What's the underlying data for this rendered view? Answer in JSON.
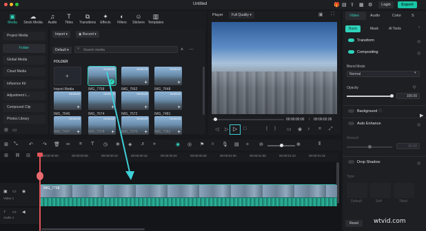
{
  "window": {
    "title": "Untitled",
    "login_label": "Login",
    "export_label": "Export"
  },
  "media_tabs": [
    {
      "label": "Media",
      "icon": "media-icon"
    },
    {
      "label": "Stock Media",
      "icon": "cloud-icon"
    },
    {
      "label": "Audio",
      "icon": "music-icon"
    },
    {
      "label": "Titles",
      "icon": "title-icon"
    },
    {
      "label": "Transitions",
      "icon": "transition-icon"
    },
    {
      "label": "Effects",
      "icon": "effects-icon"
    },
    {
      "label": "Filters",
      "icon": "filter-icon"
    },
    {
      "label": "Stickers",
      "icon": "sticker-icon"
    },
    {
      "label": "Templates",
      "icon": "template-icon"
    }
  ],
  "sidebar": {
    "items": [
      {
        "label": "Project Media"
      },
      {
        "label": "Folder"
      },
      {
        "label": "Global Media"
      },
      {
        "label": "Cloud Media"
      },
      {
        "label": "Influence Kit"
      },
      {
        "label": "Adjustment L..."
      },
      {
        "label": "Compound Clip"
      },
      {
        "label": "Photos Library"
      }
    ]
  },
  "media": {
    "import_label": "Import",
    "record_label": "Record",
    "default_label": "Default",
    "search_placeholder": "Search media",
    "folder_heading": "FOLDER",
    "items": [
      {
        "label": "Import Media",
        "duration": ""
      },
      {
        "label": "IMG_7758",
        "duration": "00:00:03"
      },
      {
        "label": "IMG_7662",
        "duration": "00:00:03"
      },
      {
        "label": "IMG_7648",
        "duration": "00:00:01"
      },
      {
        "label": "IMG_7645",
        "duration": "00:00:02"
      },
      {
        "label": "IMG_7674",
        "duration": "00:00:02"
      },
      {
        "label": "IMG_7572",
        "duration": "00:00:03"
      },
      {
        "label": "IMG_7481",
        "duration": "00:00:02"
      },
      {
        "label": "IMG_7437",
        "duration": "00:00:03"
      },
      {
        "label": "IMG_7378",
        "duration": "00:00:02"
      },
      {
        "label": "IMG_7375",
        "duration": "00:00:03"
      },
      {
        "label": "IMG_7362",
        "duration": "00:00:03"
      }
    ]
  },
  "player": {
    "label": "Player",
    "quality": "Full Quality",
    "current_time": "00:00:00:00",
    "total_time": "00:00:02:26"
  },
  "right_panel": {
    "tabs": [
      "Video",
      "Audio",
      "Color",
      "S"
    ],
    "subtabs": [
      "Basic",
      "Mask",
      "AI Tools"
    ],
    "transform_label": "Transform",
    "compositing_label": "Compositing",
    "blend_mode_label": "Blend Mode",
    "blend_mode_value": "Normal",
    "opacity_label": "Opacity",
    "opacity_value": "100.00",
    "opacity_fraction": 1.0,
    "background_label": "Background",
    "auto_enhance_label": "Auto Enhance",
    "amount_label": "Amount",
    "amount_value": "50.00",
    "drop_shadow_label": "Drop Shadow",
    "type_label": "Type",
    "shadow_types": [
      "Default",
      "Soft",
      "Tilted"
    ],
    "reset_label": "Reset"
  },
  "timeline": {
    "ticks": [
      "00:00:00:00",
      "00:00:00:05",
      "00:00:00:10",
      "00:00:00:15",
      "00:00:00:20",
      "00:00:00:25",
      "00:00:01:00",
      "00:00:01:05",
      "00:00:01:10",
      "00:00:01:15"
    ],
    "clip_label": "IMG_7758",
    "video_track_label": "Video 1",
    "audio_track_label": "Audio 1"
  },
  "watermark": "wtvid.com",
  "colors": {
    "accent": "#2fd3bb",
    "playhead": "#e2555b",
    "arrow": "#3fd0d8"
  }
}
